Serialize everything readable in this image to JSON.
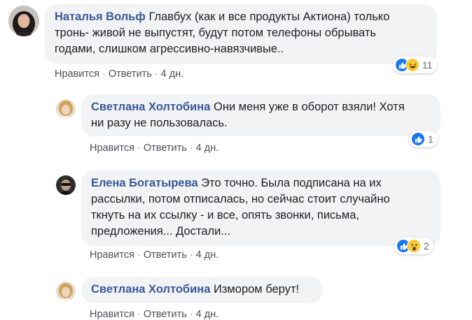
{
  "comments": [
    {
      "author": "Наталья Вольф",
      "lines": [
        "Главбух (как и все продукты Актиона) только",
        "тронь- живой не выпустят, будут потом телефоны обрывать",
        "годами, слишком агрессивно-навязчивые.."
      ],
      "like_label": "Нравится",
      "reply_label": "Ответить",
      "time": "4 дн.",
      "reactions": [
        "like-icon",
        "haha-icon"
      ],
      "reaction_count": "11"
    },
    {
      "author": "Светлана Холтобина",
      "lines": [
        "Они меня уже в оборот взяли! Хотя",
        "ни разу не пользовалась."
      ],
      "like_label": "Нравится",
      "reply_label": "Ответить",
      "time": "4 дн.",
      "reactions": [
        "like-icon"
      ],
      "reaction_count": "1"
    },
    {
      "author": "Елена Богатырева",
      "lines": [
        "Это точно. Была подписана на их",
        "рассылки, потом отписалась, но сейчас стоит случайно",
        "ткнуть на их ссылку - и все, опять звонки, письма,",
        "предложения... Достали..."
      ],
      "like_label": "Нравится",
      "reply_label": "Ответить",
      "time": "4 дн.",
      "reactions": [
        "like-icon",
        "wow-icon"
      ],
      "reaction_count": "2"
    },
    {
      "author": "Светлана Холтобина",
      "lines": [
        "Измором берут!"
      ],
      "like_label": "Нравится",
      "reply_label": "Ответить",
      "time": "4 дн."
    }
  ],
  "colors": {
    "author": "#385898",
    "bubble": "#f2f3f5",
    "like": "#1877f2",
    "emoji": "#f7c932"
  }
}
